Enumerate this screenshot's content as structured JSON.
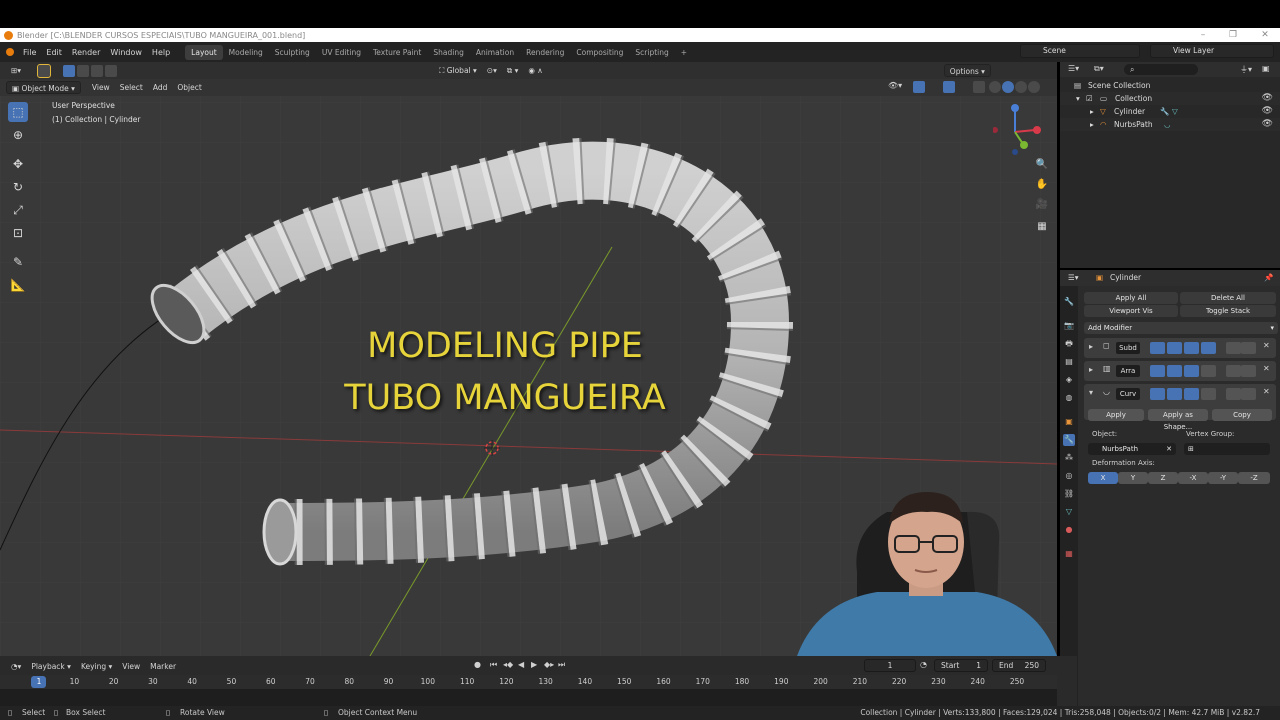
{
  "window": {
    "title": "Blender [C:\\BLENDER CURSOS ESPECIAIS\\TUBO MANGUEIRA_001.blend]"
  },
  "menu": [
    "File",
    "Edit",
    "Render",
    "Window",
    "Help"
  ],
  "workspaces": [
    "Layout",
    "Modeling",
    "Sculpting",
    "UV Editing",
    "Texture Paint",
    "Shading",
    "Animation",
    "Rendering",
    "Compositing",
    "Scripting"
  ],
  "active_workspace": "Layout",
  "scene": "Scene",
  "view_layer": "View Layer",
  "viewport": {
    "mode": "Object Mode",
    "menus": [
      "View",
      "Select",
      "Add",
      "Object"
    ],
    "transform_orientation": "Global",
    "options_label": "Options",
    "perspective": "User Perspective",
    "active_info": "(1) Collection | Cylinder",
    "overlay_title_line1": "MODELING PIPE",
    "overlay_title_line2": "TUBO MANGUEIRA"
  },
  "outliner": {
    "root": "Scene Collection",
    "items": [
      {
        "name": "Collection"
      },
      {
        "name": "Cylinder"
      },
      {
        "name": "NurbsPath"
      }
    ]
  },
  "properties": {
    "object_name": "Cylinder",
    "apply_all": "Apply All",
    "delete_all": "Delete All",
    "viewport_vis": "Viewport Vis",
    "toggle_stack": "Toggle Stack",
    "add_modifier": "Add Modifier",
    "modifiers": [
      {
        "name": "Subd"
      },
      {
        "name": "Arra"
      },
      {
        "name": "Curv"
      }
    ],
    "apply": "Apply",
    "apply_as_shape": "Apply as Shape...",
    "copy": "Copy",
    "object_label": "Object:",
    "object_value": "NurbsPath",
    "vertex_group_label": "Vertex Group:",
    "deformation_axis_label": "Deformation Axis:",
    "axes": [
      "X",
      "Y",
      "Z",
      "-X",
      "-Y",
      "-Z"
    ],
    "active_axis": "X"
  },
  "timeline": {
    "menus": [
      "Playback",
      "Keying",
      "View",
      "Marker"
    ],
    "current_frame": "1",
    "start_label": "Start",
    "start": "1",
    "end_label": "End",
    "end": "250",
    "ruler": [
      "1",
      "10",
      "20",
      "30",
      "40",
      "50",
      "60",
      "70",
      "80",
      "90",
      "100",
      "110",
      "120",
      "130",
      "140",
      "150",
      "160",
      "170",
      "180",
      "190",
      "200",
      "210",
      "220",
      "230",
      "240",
      "250"
    ]
  },
  "statusbar": {
    "select": "Select",
    "box_select": "Box Select",
    "rotate_view": "Rotate View",
    "context_menu": "Object Context Menu",
    "stats": "Collection | Cylinder | Verts:133,800 | Faces:129,024 | Tris:258,048 | Objects:0/2 | Mem: 42.7 MiB | v2.82.7"
  },
  "colors": {
    "accent": "#4772b3",
    "title_text": "#e6d43a",
    "viewport_bg": "#393939",
    "panel_bg": "#2b2b2b"
  }
}
